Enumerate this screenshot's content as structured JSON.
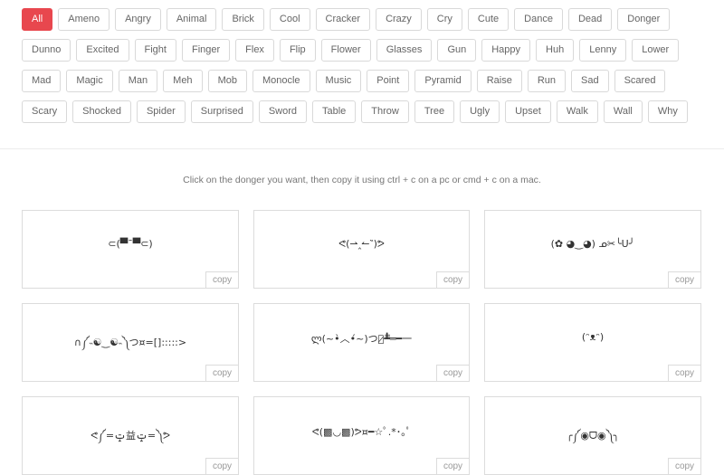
{
  "tags": [
    "All",
    "Ameno",
    "Angry",
    "Animal",
    "Brick",
    "Cool",
    "Cracker",
    "Crazy",
    "Cry",
    "Cute",
    "Dance",
    "Dead",
    "Donger",
    "Dunno",
    "Excited",
    "Fight",
    "Finger",
    "Flex",
    "Flip",
    "Flower",
    "Glasses",
    "Gun",
    "Happy",
    "Huh",
    "Lenny",
    "Lower",
    "Mad",
    "Magic",
    "Man",
    "Meh",
    "Mob",
    "Monocle",
    "Music",
    "Point",
    "Pyramid",
    "Raise",
    "Run",
    "Sad",
    "Scared",
    "Scary",
    "Shocked",
    "Spider",
    "Surprised",
    "Sword",
    "Table",
    "Throw",
    "Tree",
    "Ugly",
    "Upset",
    "Walk",
    "Wall",
    "Why"
  ],
  "active_tag": "All",
  "instructions": "Click on the donger you want, then copy it using ctrl + c on a pc or cmd + c on a mac.",
  "copy_label": "copy",
  "dongers": [
    "⊂(▀¯▀⊂)",
    "ᕙ(⇀‸↼‶)ᕗ",
    "(✿ ◕‿◕) ᓄ✂╰U╯",
    "∩༼˵☯‿☯˵༽つ¤=[]:::::>",
    "ლ(~•̀︿•́~)つ︻̷┻̿═━一",
    "(ᵔᴥᵔ)",
    "ᕙ༼=ݓ益ݓ=༽ᕗ",
    "ᕙ(▩◡▩)ᕗ¤━☆ﾟ.*･｡ﾟ",
    "╭༼◉ᗜ◉༽╮"
  ]
}
